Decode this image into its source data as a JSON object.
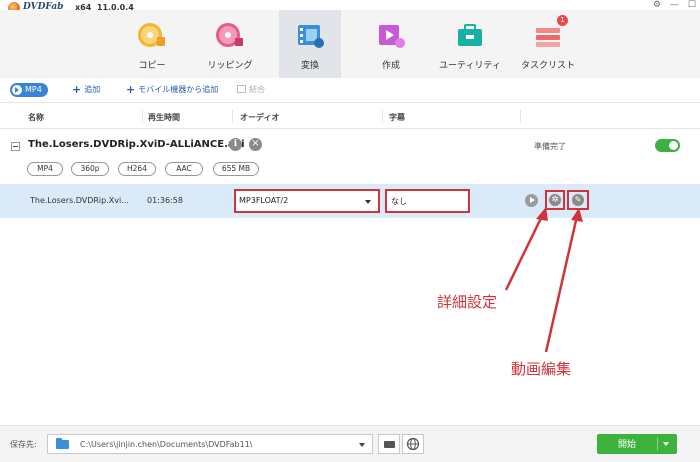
{
  "app": {
    "name": "DVDFab",
    "arch": "x64",
    "version": "11.0.0.4"
  },
  "nav": {
    "items": [
      {
        "label": "コピー",
        "icon": "copy-disc-icon"
      },
      {
        "label": "リッピング",
        "icon": "ripper-disc-icon"
      },
      {
        "label": "変換",
        "icon": "converter-film-icon",
        "active": true
      },
      {
        "label": "作成",
        "icon": "creator-icon"
      },
      {
        "label": "ユーティリティ",
        "icon": "utility-toolbox-icon"
      },
      {
        "label": "タスクリスト",
        "icon": "tasklist-icon",
        "badge": "1"
      }
    ]
  },
  "toolbar": {
    "mode_label": "MP4",
    "add_label": "追加",
    "add_mobile_label": "モバイル機器から追加",
    "merge_label": "結合"
  },
  "columns": {
    "name": "名称",
    "duration": "再生時間",
    "audio": "オーディオ",
    "subtitle": "字幕"
  },
  "file": {
    "title": "The.Losers.DVDRip.XviD-ALLiANCE.avi",
    "status": "準備完了",
    "tags": [
      "MP4",
      "360p",
      "H264",
      "AAC",
      "655 MB"
    ]
  },
  "track": {
    "name": "The.Losers.DVDRip.Xvi...",
    "duration": "01:36:58",
    "audio": "MP3FLOAT/2",
    "subtitle": "なし"
  },
  "annotations": {
    "advanced_settings": "詳細設定",
    "video_edit": "動画編集"
  },
  "footer": {
    "save_label": "保存先:",
    "path": "C:\\Users\\jinjin.chen\\Documents\\DVDFab11\\",
    "start_label": "開始"
  },
  "colors": {
    "accent_blue": "#3a84d6",
    "highlight_row": "#dbeaf8",
    "annotation_red": "#d0343a",
    "start_green": "#3db33e"
  }
}
